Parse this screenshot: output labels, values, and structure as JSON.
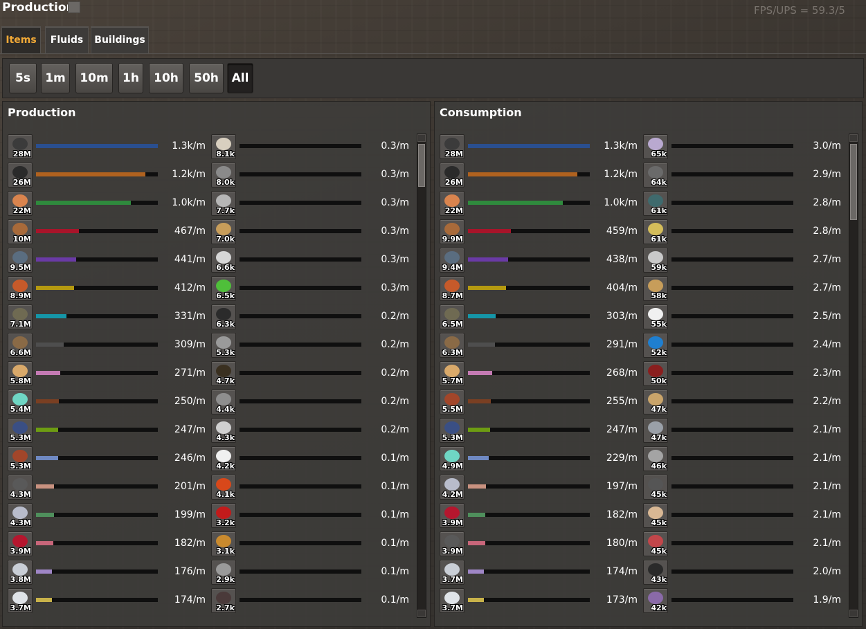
{
  "window": {
    "title": "Production",
    "fps": "FPS/UPS = 59.3/5"
  },
  "tabs": [
    {
      "label": "Items",
      "active": true
    },
    {
      "label": "Fluids",
      "active": false
    },
    {
      "label": "Buildings",
      "active": false
    }
  ],
  "time_buttons": [
    {
      "label": "5s",
      "active": false
    },
    {
      "label": "1m",
      "active": false
    },
    {
      "label": "10m",
      "active": false
    },
    {
      "label": "1h",
      "active": false
    },
    {
      "label": "10h",
      "active": false
    },
    {
      "label": "50h",
      "active": false
    },
    {
      "label": "All",
      "active": true
    }
  ],
  "production": {
    "title": "Production",
    "left": [
      {
        "icon": "coal-icon",
        "count": "28M",
        "rate": "1.3k/m",
        "bar_color": "#2a4f8f",
        "bar_fraction": 1.0
      },
      {
        "icon": "stone-icon",
        "count": "26M",
        "rate": "1.2k/m",
        "bar_color": "#b0621f",
        "bar_fraction": 0.9
      },
      {
        "icon": "wood-icon",
        "count": "22M",
        "rate": "1.0k/m",
        "bar_color": "#2f8a3d",
        "bar_fraction": 0.78
      },
      {
        "icon": "copper-ore-icon",
        "count": "10M",
        "rate": "467/m",
        "bar_color": "#a8142a",
        "bar_fraction": 0.35
      },
      {
        "icon": "iron-ore-icon",
        "count": "9.5M",
        "rate": "441/m",
        "bar_color": "#6a3aa6",
        "bar_fraction": 0.33
      },
      {
        "icon": "copper-ore-pile-icon",
        "count": "8.9M",
        "rate": "412/m",
        "bar_color": "#b59a10",
        "bar_fraction": 0.31
      },
      {
        "icon": "gold-ore-icon",
        "count": "7.1M",
        "rate": "331/m",
        "bar_color": "#1596a8",
        "bar_fraction": 0.25
      },
      {
        "icon": "sand-pile-icon",
        "count": "6.6M",
        "rate": "309/m",
        "bar_color": "#4e4e4e",
        "bar_fraction": 0.23
      },
      {
        "icon": "sand-icon",
        "count": "5.8M",
        "rate": "271/m",
        "bar_color": "#c47ab3",
        "bar_fraction": 0.2
      },
      {
        "icon": "crystal-icon",
        "count": "5.4M",
        "rate": "250/m",
        "bar_color": "#7a3f22",
        "bar_fraction": 0.19
      },
      {
        "icon": "iron-plate-icon",
        "count": "5.3M",
        "rate": "247/m",
        "bar_color": "#6d9c12",
        "bar_fraction": 0.18
      },
      {
        "icon": "copper-plate-icon",
        "count": "5.3M",
        "rate": "246/m",
        "bar_color": "#6f89c2",
        "bar_fraction": 0.18
      },
      {
        "icon": "lead-ore-icon",
        "count": "4.3M",
        "rate": "201/m",
        "bar_color": "#c99280",
        "bar_fraction": 0.15
      },
      {
        "icon": "aluminium-ore-icon",
        "count": "4.3M",
        "rate": "199/m",
        "bar_color": "#4f8f5c",
        "bar_fraction": 0.15
      },
      {
        "icon": "ruby-icon",
        "count": "3.9M",
        "rate": "182/m",
        "bar_color": "#c8667a",
        "bar_fraction": 0.14
      },
      {
        "icon": "quartz-icon",
        "count": "3.8M",
        "rate": "176/m",
        "bar_color": "#9f86c6",
        "bar_fraction": 0.13
      },
      {
        "icon": "silver-ore-icon",
        "count": "3.7M",
        "rate": "174/m",
        "bar_color": "#c8b24a",
        "bar_fraction": 0.13
      }
    ],
    "right": [
      {
        "icon": "flour-icon",
        "count": "8.1k",
        "rate": "0.3/m"
      },
      {
        "icon": "steel-plate-icon",
        "count": "8.0k",
        "rate": "0.3/m"
      },
      {
        "icon": "pipe-icon",
        "count": "7.7k",
        "rate": "0.3/m"
      },
      {
        "icon": "wood-planks-icon",
        "count": "7.0k",
        "rate": "0.3/m"
      },
      {
        "icon": "aluminium-rod-icon",
        "count": "6.6k",
        "rate": "0.3/m"
      },
      {
        "icon": "seedling-icon",
        "count": "6.5k",
        "rate": "0.3/m"
      },
      {
        "icon": "belt-icon",
        "count": "6.3k",
        "rate": "0.2/m"
      },
      {
        "icon": "pipe-elbow-icon",
        "count": "5.3k",
        "rate": "0.2/m"
      },
      {
        "icon": "lamp-icon",
        "count": "4.7k",
        "rate": "0.2/m"
      },
      {
        "icon": "chest-icon",
        "count": "4.4k",
        "rate": "0.2/m"
      },
      {
        "icon": "gears-icon",
        "count": "4.3k",
        "rate": "0.2/m"
      },
      {
        "icon": "salt-icon",
        "count": "4.2k",
        "rate": "0.1/m"
      },
      {
        "icon": "furnace-icon",
        "count": "4.1k",
        "rate": "0.1/m"
      },
      {
        "icon": "red-cable-icon",
        "count": "3.2k",
        "rate": "0.1/m"
      },
      {
        "icon": "robot-icon",
        "count": "3.1k",
        "rate": "0.1/m"
      },
      {
        "icon": "inserter-icon",
        "count": "2.9k",
        "rate": "0.1/m"
      },
      {
        "icon": "circuit-icon",
        "count": "2.7k",
        "rate": "0.1/m"
      }
    ]
  },
  "consumption": {
    "title": "Consumption",
    "left": [
      {
        "icon": "coal-icon",
        "count": "28M",
        "rate": "1.3k/m",
        "bar_color": "#2a4f8f",
        "bar_fraction": 1.0
      },
      {
        "icon": "stone-icon",
        "count": "26M",
        "rate": "1.2k/m",
        "bar_color": "#b0621f",
        "bar_fraction": 0.9
      },
      {
        "icon": "wood-icon",
        "count": "22M",
        "rate": "1.0k/m",
        "bar_color": "#2f8a3d",
        "bar_fraction": 0.78
      },
      {
        "icon": "copper-ore-icon",
        "count": "9.9M",
        "rate": "459/m",
        "bar_color": "#a8142a",
        "bar_fraction": 0.35
      },
      {
        "icon": "iron-ore-icon",
        "count": "9.4M",
        "rate": "438/m",
        "bar_color": "#6a3aa6",
        "bar_fraction": 0.33
      },
      {
        "icon": "copper-ore-pile-icon",
        "count": "8.7M",
        "rate": "404/m",
        "bar_color": "#b59a10",
        "bar_fraction": 0.31
      },
      {
        "icon": "gold-ore-icon",
        "count": "6.5M",
        "rate": "303/m",
        "bar_color": "#1596a8",
        "bar_fraction": 0.23
      },
      {
        "icon": "sand-pile-icon",
        "count": "6.3M",
        "rate": "291/m",
        "bar_color": "#4e4e4e",
        "bar_fraction": 0.22
      },
      {
        "icon": "sand-icon",
        "count": "5.7M",
        "rate": "268/m",
        "bar_color": "#c47ab3",
        "bar_fraction": 0.2
      },
      {
        "icon": "copper-plate-icon",
        "count": "5.5M",
        "rate": "255/m",
        "bar_color": "#7a3f22",
        "bar_fraction": 0.19
      },
      {
        "icon": "iron-plate-icon",
        "count": "5.3M",
        "rate": "247/m",
        "bar_color": "#6d9c12",
        "bar_fraction": 0.18
      },
      {
        "icon": "crystal-icon",
        "count": "4.9M",
        "rate": "229/m",
        "bar_color": "#6f89c2",
        "bar_fraction": 0.17
      },
      {
        "icon": "aluminium-ore-icon",
        "count": "4.2M",
        "rate": "197/m",
        "bar_color": "#c99280",
        "bar_fraction": 0.15
      },
      {
        "icon": "ruby-icon",
        "count": "3.9M",
        "rate": "182/m",
        "bar_color": "#4f8f5c",
        "bar_fraction": 0.14
      },
      {
        "icon": "lead-ore-icon",
        "count": "3.9M",
        "rate": "180/m",
        "bar_color": "#c8667a",
        "bar_fraction": 0.14
      },
      {
        "icon": "quartz-icon",
        "count": "3.7M",
        "rate": "174/m",
        "bar_color": "#9f86c6",
        "bar_fraction": 0.13
      },
      {
        "icon": "silver-ore-icon",
        "count": "3.7M",
        "rate": "173/m",
        "bar_color": "#c8b24a",
        "bar_fraction": 0.13
      }
    ],
    "right": [
      {
        "icon": "amethyst-icon",
        "count": "65k",
        "rate": "3.0/m"
      },
      {
        "icon": "graphite-icon",
        "count": "64k",
        "rate": "2.9/m"
      },
      {
        "icon": "cooked-fish-icon",
        "count": "61k",
        "rate": "2.8/m"
      },
      {
        "icon": "wheat-icon",
        "count": "61k",
        "rate": "2.8/m"
      },
      {
        "icon": "glass-icon",
        "count": "59k",
        "rate": "2.7/m"
      },
      {
        "icon": "wood-planks-icon",
        "count": "58k",
        "rate": "2.7/m"
      },
      {
        "icon": "salt-icon",
        "count": "55k",
        "rate": "2.5/m"
      },
      {
        "icon": "sapphire-icon",
        "count": "52k",
        "rate": "2.4/m"
      },
      {
        "icon": "circuit-board-icon",
        "count": "50k",
        "rate": "2.3/m"
      },
      {
        "icon": "crate-icon",
        "count": "47k",
        "rate": "2.2/m"
      },
      {
        "icon": "iron-ore-chunk-icon",
        "count": "47k",
        "rate": "2.1/m"
      },
      {
        "icon": "steel-gear-icon",
        "count": "46k",
        "rate": "2.1/m"
      },
      {
        "icon": "coal-chunk-icon",
        "count": "45k",
        "rate": "2.1/m"
      },
      {
        "icon": "paper-icon",
        "count": "45k",
        "rate": "2.1/m"
      },
      {
        "icon": "meat-icon",
        "count": "45k",
        "rate": "2.1/m"
      },
      {
        "icon": "tire-icon",
        "count": "43k",
        "rate": "2.0/m"
      },
      {
        "icon": "amethyst-shard-icon",
        "count": "42k",
        "rate": "1.9/m"
      }
    ]
  },
  "icon_colors": {
    "coal-icon": "#3b3b3b",
    "stone-icon": "#2a2a2a",
    "wood-icon": "#d9844e",
    "copper-ore-icon": "#a86a3a",
    "iron-ore-icon": "#5a6d80",
    "copper-ore-pile-icon": "#c65a2a",
    "gold-ore-icon": "#6f6a52",
    "sand-pile-icon": "#8a6a46",
    "sand-icon": "#d9a96a",
    "crystal-icon": "#6fd6c4",
    "iron-plate-icon": "#3a4f84",
    "copper-plate-icon": "#a2462a",
    "lead-ore-icon": "#595959",
    "aluminium-ore-icon": "#b8bccb",
    "ruby-icon": "#b5162e",
    "quartz-icon": "#c9ced6",
    "silver-ore-icon": "#dfe3e8",
    "flour-icon": "#d8cfbf",
    "steel-plate-icon": "#8a8a8a",
    "pipe-icon": "#b6b6b6",
    "wood-planks-icon": "#c79d5a",
    "aluminium-rod-icon": "#d6d6d6",
    "seedling-icon": "#4fbf3a",
    "belt-icon": "#2b2b2b",
    "pipe-elbow-icon": "#9a9a9a",
    "lamp-icon": "#3a3020",
    "chest-icon": "#8e8e8e",
    "gears-icon": "#d0d0d0",
    "salt-icon": "#f0f0f0",
    "furnace-icon": "#d8481a",
    "red-cable-icon": "#c21b1b",
    "robot-icon": "#c98a2e",
    "inserter-icon": "#9a9a9a",
    "circuit-icon": "#4a3a3a",
    "amethyst-icon": "#b9a9d0",
    "graphite-icon": "#6a6a6a",
    "cooked-fish-icon": "#3f6a6d",
    "wheat-icon": "#d4bd5a",
    "glass-icon": "#c9c9c9",
    "sapphire-icon": "#1f7fd0",
    "circuit-board-icon": "#8a1e1e",
    "crate-icon": "#c9a46a",
    "iron-ore-chunk-icon": "#9aa0a8",
    "steel-gear-icon": "#a4a4a4",
    "coal-chunk-icon": "#555",
    "paper-icon": "#d9b894",
    "meat-icon": "#c2464a",
    "tire-icon": "#2a2a2a",
    "amethyst-shard-icon": "#8a6aa8"
  }
}
